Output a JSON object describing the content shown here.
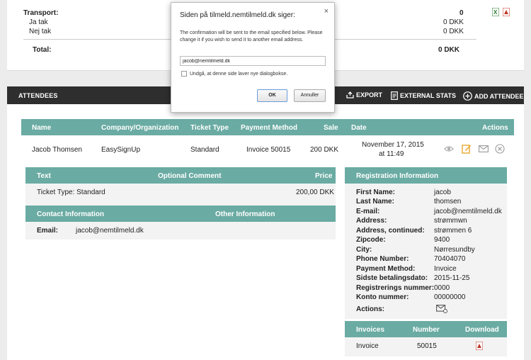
{
  "transport": {
    "label": "Transport:",
    "count": "0",
    "rows": [
      {
        "label": "Ja tak",
        "value": "0 DKK"
      },
      {
        "label": "Nej tak",
        "value": "0 DKK"
      }
    ],
    "total_label": "Total:",
    "total_value": "0 DKK"
  },
  "attendees_bar": {
    "title": "ATTENDEES",
    "export": "EXPORT",
    "external_stats": "EXTERNAL STATS",
    "add_attendee": "ADD ATTENDEE"
  },
  "table": {
    "headers": [
      "Name",
      "Company/Organization",
      "Ticket Type",
      "Payment Method",
      "Sale",
      "Date",
      "Actions"
    ],
    "row": {
      "name": "Jacob Thomsen",
      "company": "EasySignUp",
      "ticket_type": "Standard",
      "payment_method": "Invoice 50015",
      "sale": "200 DKK",
      "date_line1": "November 17, 2015",
      "date_line2": "at 11:49"
    }
  },
  "details": {
    "headers": [
      "Text",
      "Optional Comment",
      "Price"
    ],
    "rows": [
      {
        "text": "Ticket Type: Standard",
        "comment": "",
        "price": "200,00 DKK"
      }
    ]
  },
  "contact": {
    "headers": [
      "Contact Information",
      "Other Information"
    ],
    "email_label": "Email:",
    "email_value": "jacob@nemtilmeld.dk"
  },
  "registration": {
    "header": "Registration Information",
    "fields": [
      {
        "label": "First Name:",
        "value": "jacob"
      },
      {
        "label": "Last Name:",
        "value": "thomsen"
      },
      {
        "label": "E-mail:",
        "value": "jacob@nemtilmeld.dk"
      },
      {
        "label": "Address:",
        "value": "strømmwn"
      },
      {
        "label": "Address, continued:",
        "value": "strømmen 6"
      },
      {
        "label": "Zipcode:",
        "value": "9400"
      },
      {
        "label": "City:",
        "value": "Nørresundby"
      },
      {
        "label": "Phone Number:",
        "value": "70404070"
      },
      {
        "label": "Payment Method:",
        "value": "Invoice"
      },
      {
        "label": "Sidste betalingsdato:",
        "value": "2015-11-25"
      },
      {
        "label": "Registrerings nummer:",
        "value": "0000"
      },
      {
        "label": "Konto nummer:",
        "value": "00000000"
      }
    ],
    "actions_label": "Actions:"
  },
  "invoices": {
    "headers": [
      "Invoices",
      "Number",
      "Download"
    ],
    "rows": [
      {
        "type": "Invoice",
        "number": "50015"
      }
    ]
  },
  "dialog": {
    "title": "Siden på tilmeld.nemtilmeld.dk siger:",
    "message": "The confirmation will be sent to the email specified below. Please change it if you wish to send it to another email address.",
    "input_value": "jacob@nemtilmeld.dk",
    "checkbox_label": "Undgå, at denne side laver nye dialogbokse.",
    "ok_label": "OK",
    "cancel_label": "Annuller"
  },
  "colors": {
    "teal": "#6aaba3",
    "dark_bar": "#2e2e2e",
    "orange": "#e8a020"
  }
}
